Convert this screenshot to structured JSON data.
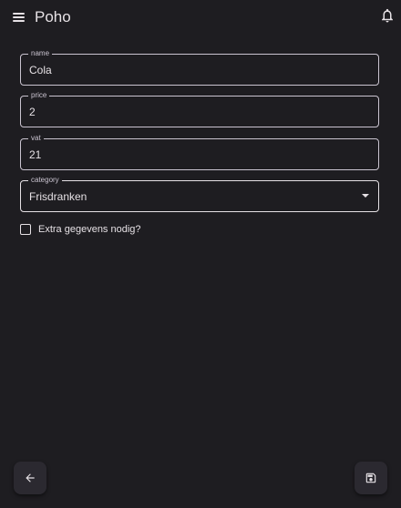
{
  "app": {
    "title": "Poho"
  },
  "form": {
    "name": {
      "label": "name",
      "value": "Cola"
    },
    "price": {
      "label": "price",
      "value": "2"
    },
    "vat": {
      "label": "vat",
      "value": "21"
    },
    "category": {
      "label": "category",
      "value": "Frisdranken"
    },
    "extra": {
      "label": "Extra gegevens nodig?",
      "checked": false
    }
  },
  "icons": {
    "menu": "menu-icon",
    "bell": "bell-icon",
    "back": "arrow-left-icon",
    "save": "save-icon"
  },
  "colors": {
    "background": "#1e1d21",
    "text": "#e6e1e5",
    "outline": "#cac4d0",
    "fab": "#2b2930"
  }
}
